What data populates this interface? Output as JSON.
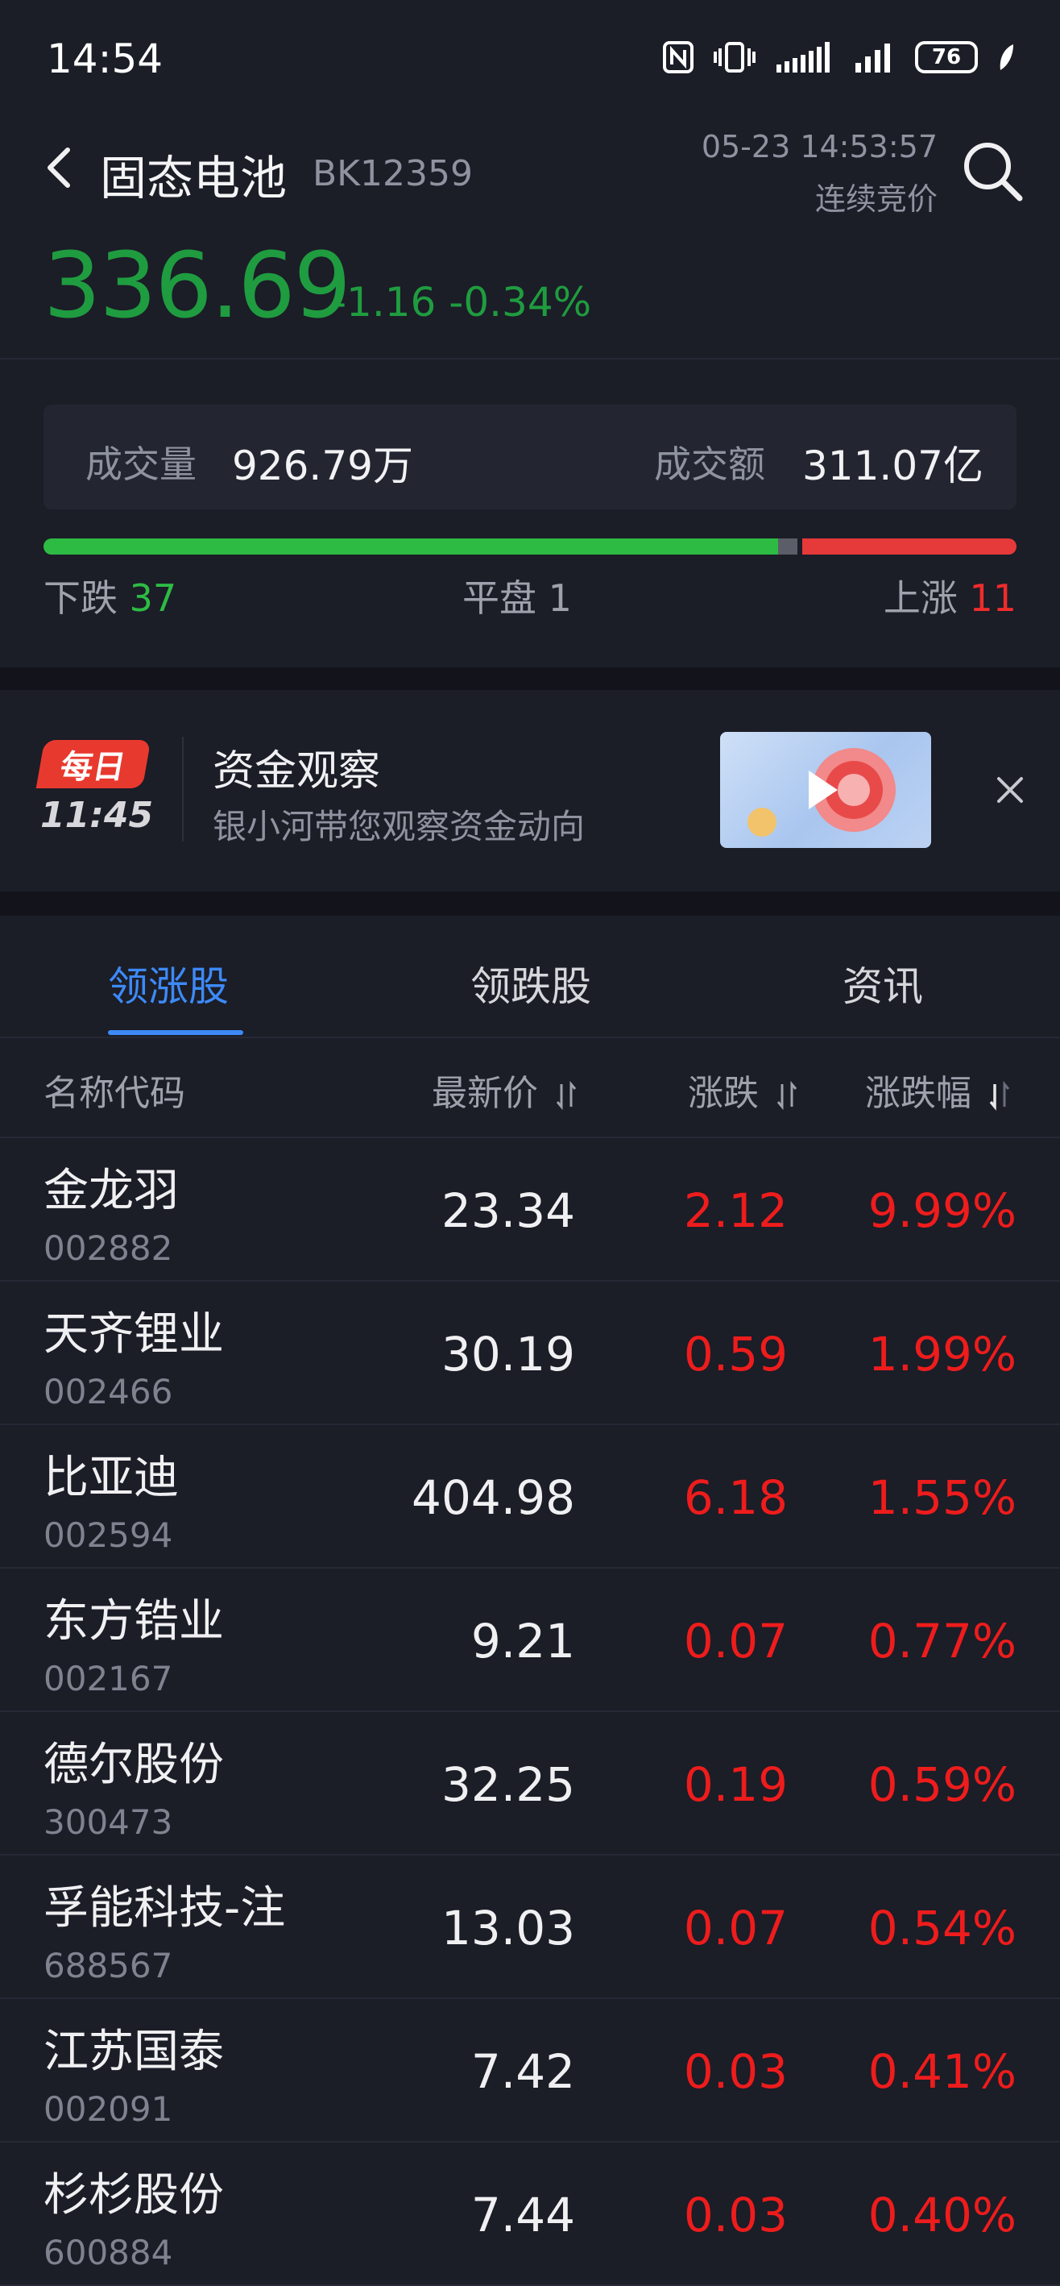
{
  "status_bar": {
    "time": "14:54",
    "battery": "76"
  },
  "header": {
    "title": "固态电池",
    "code": "BK12359",
    "timestamp": "05-23 14:53:57",
    "trading_status": "连续竞价"
  },
  "quote": {
    "price": "336.69",
    "change": "-1.16",
    "change_pct": "-0.34%"
  },
  "volume": {
    "volume_label": "成交量",
    "volume_value": "926.79万",
    "amount_label": "成交额",
    "amount_value": "311.07亿"
  },
  "breadth": {
    "down_label": "下跌",
    "down_count": "37",
    "flat_label": "平盘",
    "flat_count": "1",
    "up_label": "上涨",
    "up_count": "11",
    "down_fraction": 0.755,
    "flat_fraction": 0.02,
    "up_fraction": 0.225,
    "colors": {
      "down": "#2dbb44",
      "flat": "#5b5e68",
      "up": "#e6393a"
    }
  },
  "banner": {
    "badge_label": "每日",
    "badge_time": "11:45",
    "title": "资金观察",
    "subtitle": "银小河带您观察资金动向"
  },
  "tabs": [
    {
      "label": "领涨股",
      "active": true
    },
    {
      "label": "领跌股",
      "active": false
    },
    {
      "label": "资讯",
      "active": false
    }
  ],
  "columns": {
    "name": "名称代码",
    "price": "最新价",
    "change": "涨跌",
    "change_pct": "涨跌幅"
  },
  "rows": [
    {
      "name": "金龙羽",
      "code": "002882",
      "price": "23.34",
      "change": "2.12",
      "pct": "9.99%"
    },
    {
      "name": "天齐锂业",
      "code": "002466",
      "price": "30.19",
      "change": "0.59",
      "pct": "1.99%"
    },
    {
      "name": "比亚迪",
      "code": "002594",
      "price": "404.98",
      "change": "6.18",
      "pct": "1.55%"
    },
    {
      "name": "东方锆业",
      "code": "002167",
      "price": "9.21",
      "change": "0.07",
      "pct": "0.77%"
    },
    {
      "name": "德尔股份",
      "code": "300473",
      "price": "32.25",
      "change": "0.19",
      "pct": "0.59%"
    },
    {
      "name": "孚能科技-注",
      "code": "688567",
      "price": "13.03",
      "change": "0.07",
      "pct": "0.54%"
    },
    {
      "name": "江苏国泰",
      "code": "002091",
      "price": "7.42",
      "change": "0.03",
      "pct": "0.41%"
    },
    {
      "name": "杉杉股份",
      "code": "600884",
      "price": "7.44",
      "change": "0.03",
      "pct": "0.40%"
    }
  ],
  "colors": {
    "accent": "#3d8af7",
    "down": "#1f9c3f",
    "up": "#ee1c1c",
    "background": "#1b1d27"
  }
}
